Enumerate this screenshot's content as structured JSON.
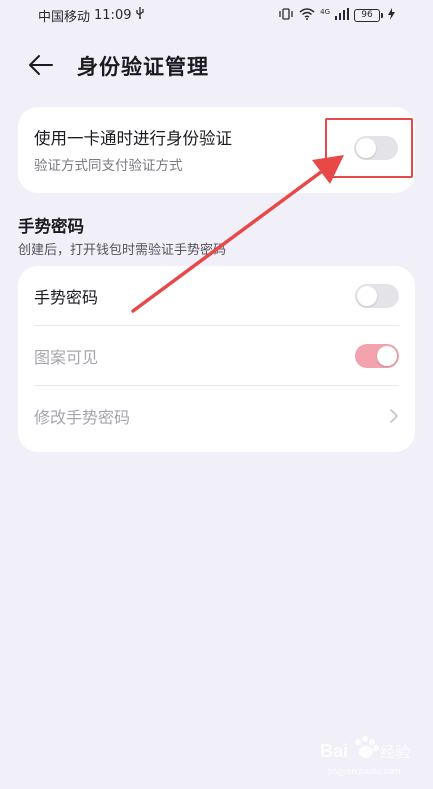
{
  "status_bar": {
    "carrier": "中国移动",
    "time": "11:09",
    "network": "4G",
    "battery": "96"
  },
  "header": {
    "title": "身份验证管理"
  },
  "card_onecard": {
    "title": "使用一卡通时进行身份验证",
    "subtitle": "验证方式同支付验证方式",
    "toggle_on": false
  },
  "gesture_section": {
    "title": "手势密码",
    "subtitle": "创建后，打开钱包时需验证手势密码",
    "items": [
      {
        "label": "手势密码",
        "toggle_on": false
      },
      {
        "label": "图案可见",
        "toggle_on": true,
        "disabled": true
      },
      {
        "label": "修改手势密码",
        "disabled": true
      }
    ]
  },
  "colors": {
    "background": "#f1eff8",
    "card": "#ffffff",
    "annotation": "#e84848",
    "toggle_off": "#e4e3e8",
    "toggle_on_disabled": "#f3a3ad"
  }
}
